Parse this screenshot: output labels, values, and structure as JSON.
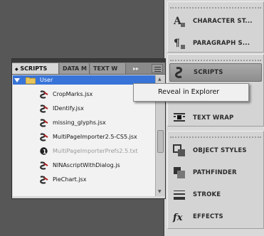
{
  "dock": {
    "items": [
      {
        "label": "CHARACTER ST...",
        "icon": "character-styles-icon"
      },
      {
        "label": "PARAGRAPH S...",
        "icon": "paragraph-styles-icon"
      },
      {
        "label": "SCRIPTS",
        "icon": "scripts-icon"
      },
      {
        "label": "TEXT WRAP",
        "icon": "text-wrap-icon"
      },
      {
        "label": "OBJECT STYLES",
        "icon": "object-styles-icon"
      },
      {
        "label": "PATHFINDER",
        "icon": "pathfinder-icon"
      },
      {
        "label": "STROKE",
        "icon": "stroke-icon"
      },
      {
        "label": "EFFECTS",
        "icon": "effects-icon"
      }
    ]
  },
  "panel": {
    "tabs": [
      "SCRIPTS",
      "DATA M",
      "TEXT W"
    ],
    "tab_arrows": "▸▸",
    "folder": "User",
    "files": [
      {
        "name": "CropMarks.jsx",
        "icon": "script-file-icon"
      },
      {
        "name": "IDentify.jsx",
        "icon": "script-file-icon"
      },
      {
        "name": "missing_glyphs.jsx",
        "icon": "script-file-icon"
      },
      {
        "name": "MultiPageImporter2.5-CS5.jsx",
        "icon": "script-file-icon"
      },
      {
        "name": "MultiPageImporterPrefs2.5.txt",
        "icon": "info-icon"
      },
      {
        "name": "NINAscriptWithDialog.js",
        "icon": "script-file-icon"
      },
      {
        "name": "PieChart.jsx",
        "icon": "script-file-icon"
      }
    ]
  },
  "context_menu": {
    "items": [
      "Reveal in Explorer"
    ]
  },
  "colors": {
    "selection": "#3874d8",
    "background": "#575757",
    "dock": "#d9d9d9"
  }
}
